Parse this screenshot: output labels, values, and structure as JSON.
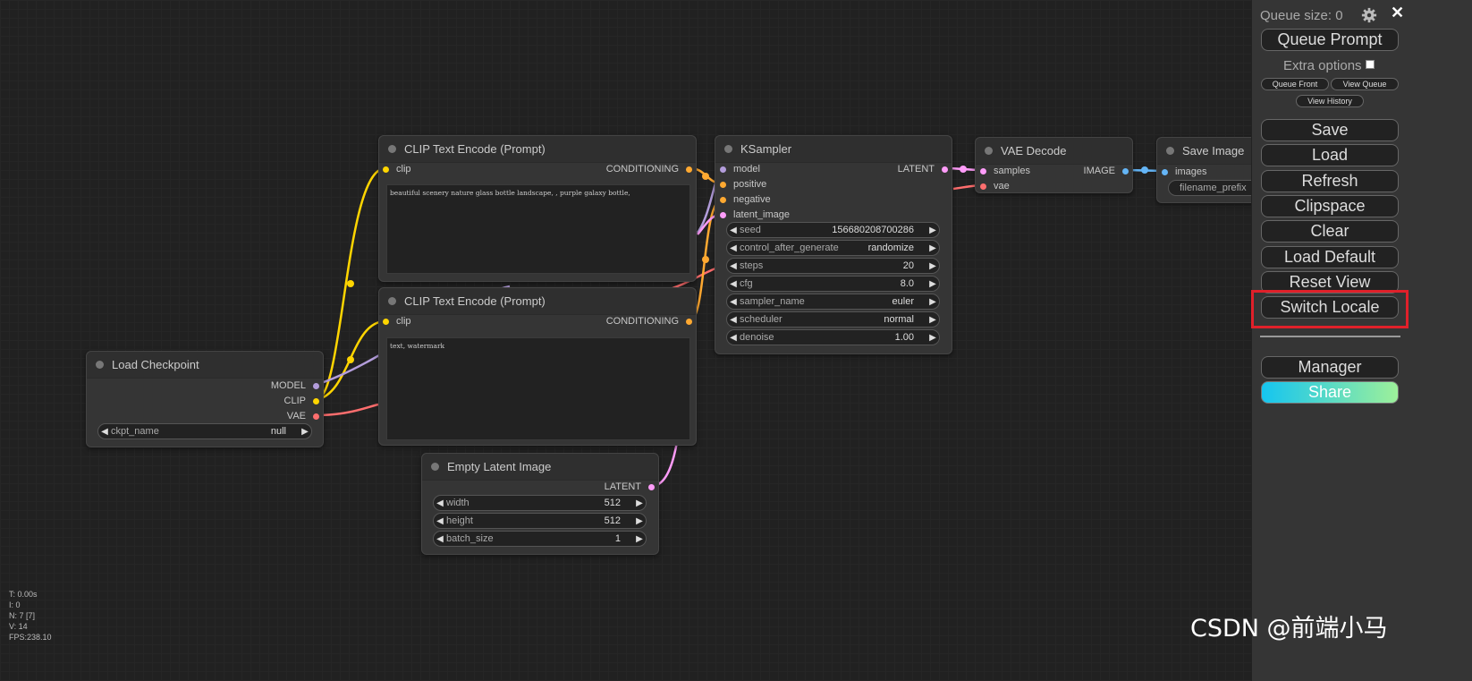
{
  "colors": {
    "model": "#b39ddb",
    "clip": "#ffd500",
    "vae": "#ff6e6e",
    "conditioning": "#ffa931",
    "latent": "#ff9cf9",
    "image": "#64b5f6",
    "highlight": "#e0202a"
  },
  "nodes": {
    "checkpoint": {
      "title": "Load Checkpoint",
      "outputs": [
        "MODEL",
        "CLIP",
        "VAE"
      ],
      "ckpt": {
        "name": "ckpt_name",
        "value": "null"
      }
    },
    "clip_pos": {
      "title": "CLIP Text Encode (Prompt)",
      "input": "clip",
      "output": "CONDITIONING",
      "text": "beautiful scenery nature glass bottle landscape, , purple galaxy bottle,"
    },
    "clip_neg": {
      "title": "CLIP Text Encode (Prompt)",
      "input": "clip",
      "output": "CONDITIONING",
      "text": "text, watermark"
    },
    "empty_latent": {
      "title": "Empty Latent Image",
      "output": "LATENT",
      "widgets": [
        {
          "name": "width",
          "value": "512"
        },
        {
          "name": "height",
          "value": "512"
        },
        {
          "name": "batch_size",
          "value": "1"
        }
      ]
    },
    "ksampler": {
      "title": "KSampler",
      "inputs": [
        "model",
        "positive",
        "negative",
        "latent_image"
      ],
      "output": "LATENT",
      "widgets": [
        {
          "name": "seed",
          "value": "156680208700286"
        },
        {
          "name": "control_after_generate",
          "value": "randomize"
        },
        {
          "name": "steps",
          "value": "20"
        },
        {
          "name": "cfg",
          "value": "8.0"
        },
        {
          "name": "sampler_name",
          "value": "euler"
        },
        {
          "name": "scheduler",
          "value": "normal"
        },
        {
          "name": "denoise",
          "value": "1.00"
        }
      ]
    },
    "vae_decode": {
      "title": "VAE Decode",
      "inputs": [
        "samples",
        "vae"
      ],
      "output": "IMAGE"
    },
    "save_image": {
      "title": "Save Image",
      "input": "images",
      "widget": "filename_prefix"
    }
  },
  "menu": {
    "queue_size": "Queue size: 0",
    "queue_prompt": "Queue Prompt",
    "extra_options": "Extra options",
    "queue_front": "Queue Front",
    "view_queue": "View Queue",
    "view_history": "View History",
    "buttons": [
      "Save",
      "Load",
      "Refresh",
      "Clipspace",
      "Clear",
      "Load Default",
      "Reset View",
      "Switch Locale"
    ],
    "manager": "Manager",
    "share": "Share"
  },
  "stats": [
    "T: 0.00s",
    "I: 0",
    "N: 7 [7]",
    "V: 14",
    "FPS:238.10"
  ],
  "watermark": "CSDN @前端小马"
}
